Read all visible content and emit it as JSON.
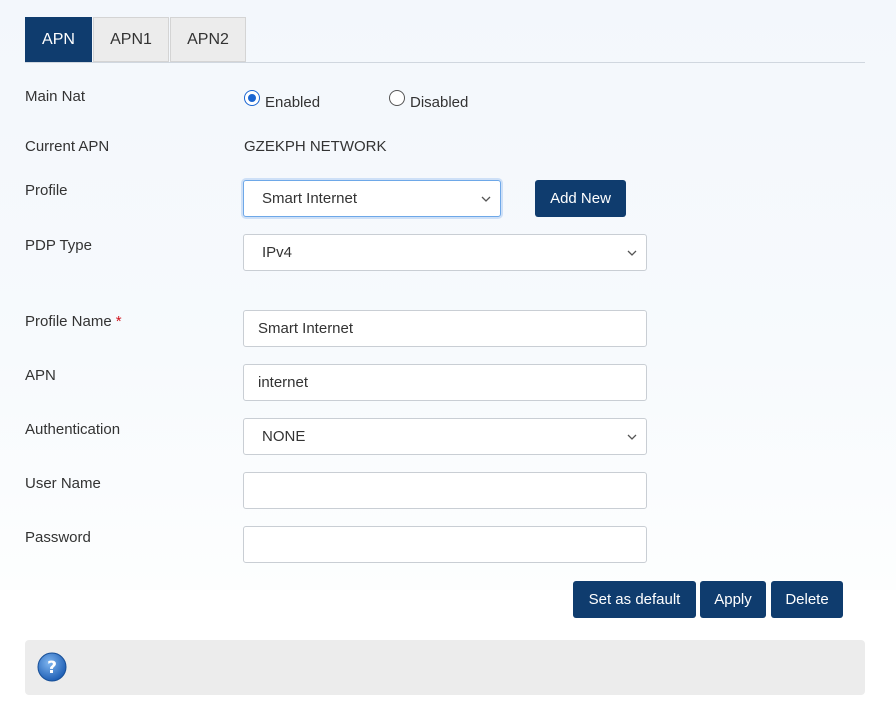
{
  "tabs": [
    {
      "label": "APN",
      "active": true
    },
    {
      "label": "APN1",
      "active": false
    },
    {
      "label": "APN2",
      "active": false
    }
  ],
  "form": {
    "main_nat": {
      "label": "Main Nat",
      "options": [
        "Enabled",
        "Disabled"
      ],
      "selected": "Enabled"
    },
    "current_apn": {
      "label": "Current APN",
      "value": "GZEKPH NETWORK"
    },
    "profile": {
      "label": "Profile",
      "selected": "Smart Internet",
      "add_new_label": "Add New"
    },
    "pdp_type": {
      "label": "PDP Type",
      "selected": "IPv4"
    },
    "profile_name": {
      "label": "Profile Name",
      "required_mark": "*",
      "value": "Smart Internet"
    },
    "apn": {
      "label": "APN",
      "value": "internet"
    },
    "authentication": {
      "label": "Authentication",
      "selected": "NONE"
    },
    "user_name": {
      "label": "User Name",
      "value": ""
    },
    "password": {
      "label": "Password",
      "value": ""
    }
  },
  "actions": {
    "set_default_label": "Set as default",
    "apply_label": "Apply",
    "delete_label": "Delete"
  },
  "help": {
    "icon": "question-circle-icon"
  },
  "colors": {
    "primary": "#0f3c6e",
    "radio_accent": "#1a66d2",
    "required": "#d0141e"
  }
}
